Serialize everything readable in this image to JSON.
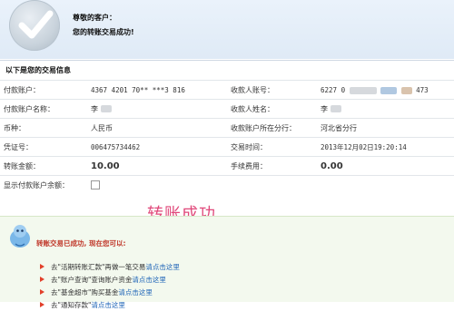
{
  "header": {
    "greeting": "尊敬的客户：",
    "message": "您的转账交易成功!"
  },
  "section_title": "以下是您的交易信息",
  "rows": [
    {
      "l1": "付款账户：",
      "v1": "4367 4201 70** ***3 816",
      "l2": "收款人账号：",
      "v2a": "6227 0",
      "v2b": "473"
    },
    {
      "l1": "付款账户名称：",
      "v1": "李",
      "l2": "收款人姓名：",
      "v2a": "李"
    },
    {
      "l1": "币种：",
      "v1": "人民币",
      "l2": "收款账户所在分行：",
      "v2a": "河北省分行"
    },
    {
      "l1": "凭证号：",
      "v1": "006475734462",
      "l2": "交易时间：",
      "v2a": "2013年12月02日19:20:14"
    },
    {
      "l1": "转账金额：",
      "v1": "10.00",
      "l2": "手续费用：",
      "v2a": "0.00"
    },
    {
      "l1": "显示付款账户余额："
    }
  ],
  "watermark": "转账成功",
  "success": {
    "message": "转账交易已成功, 现在您可以:",
    "links": [
      {
        "prefix": "去\"活期转账汇款\"再做一笔交易",
        "link": "请点击这里"
      },
      {
        "prefix": "去\"账户查询\"查询账户资金",
        "link": "请点击这里"
      },
      {
        "prefix": "去\"基金超市\"购买基金",
        "link": "请点击这里"
      },
      {
        "prefix": "去\"通知存款\"",
        "link": "请点击这里"
      }
    ]
  },
  "colors": {
    "amount": "#e2402a",
    "link": "#2166b8",
    "header_bg": "#dfeaf6",
    "success_bg": "#f3f9ee"
  },
  "icons": [
    "checkmark-icon",
    "mascot-icon",
    "arrow-icon"
  ]
}
